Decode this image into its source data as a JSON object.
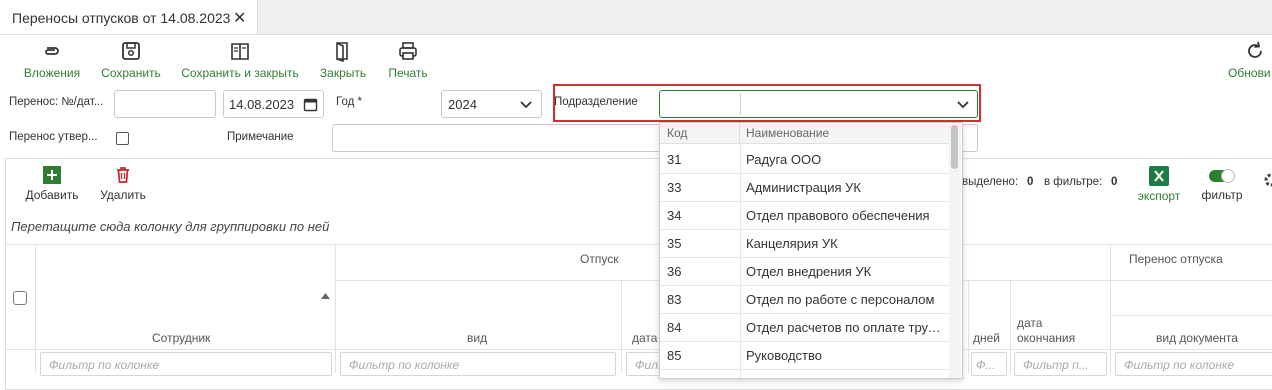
{
  "tab": {
    "title": "Переносы отпусков от 14.08.2023",
    "close": "✕"
  },
  "toolbar": {
    "attachments": "Вложения",
    "save": "Сохранить",
    "save_close": "Сохранить и закрыть",
    "close": "Закрыть",
    "print": "Печать",
    "refresh": "Обнови"
  },
  "form": {
    "transfer_label": "Перенос: №/дат...",
    "transfer_value": "",
    "date_value": "14.08.2023",
    "year_label": "Год *",
    "year_value": "2024",
    "division_label": "Подразделение",
    "division_value": "",
    "approved_label": "Перенос утвер...",
    "note_label": "Примечание"
  },
  "grid": {
    "add": "Добавить",
    "delete": "Удалить",
    "group_hint": "Перетащите сюда колонку для группировки по ней",
    "selected_label": "выделено:",
    "selected_count": "0",
    "in_filter_label": "в фильтре:",
    "in_filter_count": "0",
    "export": "экспорт",
    "filter": "фильтр",
    "group_vacation": "Отпуск",
    "group_transfer": "Перенос отпуска",
    "col_employee": "Сотрудник",
    "col_kind": "вид",
    "col_date": "дата",
    "col_days": "дней",
    "col_end_date": "дата окончания",
    "col_doc_kind": "вид документа",
    "filter_placeholder": "Фильтр по колонке",
    "filter_placeholder_short": "Ф...",
    "filter_placeholder_mid": "Фильтр п..."
  },
  "dropdown": {
    "col_code": "Код",
    "col_name": "Наименование",
    "rows": [
      {
        "code": "31",
        "name": "Радуга ООО"
      },
      {
        "code": "33",
        "name": "Администрация УК"
      },
      {
        "code": "34",
        "name": "Отдел правового обеспечения"
      },
      {
        "code": "35",
        "name": "Канцелярия УК"
      },
      {
        "code": "36",
        "name": "Отдел внедрения УК"
      },
      {
        "code": "83",
        "name": "Отдел по работе с персоналом"
      },
      {
        "code": "84",
        "name": "Отдел расчетов по оплате труда"
      },
      {
        "code": "85",
        "name": "Руководство"
      }
    ]
  },
  "colors": {
    "accent": "#2e7d32",
    "danger": "#c62828",
    "highlight": "#d32f2f",
    "excel": "#1e7b45"
  }
}
